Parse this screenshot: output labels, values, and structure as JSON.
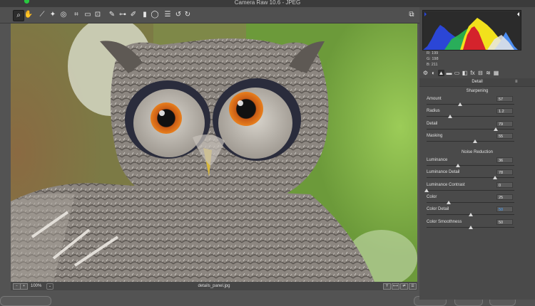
{
  "window": {
    "title": "Camera Raw 10.6  -  JPEG"
  },
  "toolbar": {
    "tools": [
      {
        "name": "zoom-tool",
        "glyph": "⌕",
        "active": true
      },
      {
        "name": "hand-tool",
        "glyph": "✋",
        "active": false
      },
      {
        "name": "white-balance-tool",
        "glyph": "⟋",
        "active": false
      },
      {
        "name": "color-sampler-tool",
        "glyph": "✦",
        "active": false
      },
      {
        "name": "targeted-adjustment-tool",
        "glyph": "◎",
        "active": false
      },
      {
        "name": "crop-tool",
        "glyph": "⌗",
        "active": false
      },
      {
        "name": "straighten-tool",
        "glyph": "▭",
        "active": false
      },
      {
        "name": "transform-tool",
        "glyph": "⊡",
        "active": false
      },
      {
        "name": "spot-removal-tool",
        "glyph": "✎",
        "active": false
      },
      {
        "name": "red-eye-tool",
        "glyph": "⊶",
        "active": false
      },
      {
        "name": "adjustment-brush-tool",
        "glyph": "✐",
        "active": false
      },
      {
        "name": "graduated-filter-tool",
        "glyph": "▮",
        "active": false
      },
      {
        "name": "radial-filter-tool",
        "glyph": "◯",
        "active": false
      },
      {
        "name": "preferences-tool",
        "glyph": "☰",
        "active": false
      },
      {
        "name": "rotate-left-tool",
        "glyph": "↺",
        "active": false
      },
      {
        "name": "rotate-right-tool",
        "glyph": "↻",
        "active": false
      }
    ],
    "fullscreen_glyph": "⧉"
  },
  "status": {
    "zoom": "100%",
    "zoom_arrow": "⌄",
    "filename": "details_panel.jpg",
    "left_buttons": [
      "−",
      "+"
    ],
    "view_buttons": [
      "Y",
      "⟷",
      "⇄",
      "☰"
    ]
  },
  "histogram": {
    "r_label": "R:",
    "r_value": "199",
    "g_label": "G:",
    "g_value": "198",
    "b_label": "B:",
    "b_value": "211"
  },
  "panel": {
    "tab_icons": [
      "⚙",
      "◐",
      "▲",
      "▬",
      "▭",
      "◧",
      "fx",
      "⊟",
      "≋",
      "▦"
    ],
    "title": "Detail",
    "sharpening": {
      "heading": "Sharpening",
      "rows": [
        {
          "label": "Amount",
          "value": "57",
          "pos": 0.38
        },
        {
          "label": "Radius",
          "value": "1.2",
          "pos": 0.27
        },
        {
          "label": "Detail",
          "value": "79",
          "pos": 0.79
        },
        {
          "label": "Masking",
          "value": "55",
          "pos": 0.55
        }
      ]
    },
    "noise": {
      "heading": "Noise Reduction",
      "rows": [
        {
          "label": "Luminance",
          "value": "36",
          "pos": 0.36
        },
        {
          "label": "Luminance Detail",
          "value": "78",
          "pos": 0.78
        },
        {
          "label": "Luminance Contrast",
          "value": "0",
          "pos": 0.0
        },
        {
          "label": "Color",
          "value": "25",
          "pos": 0.25
        },
        {
          "label": "Color Detail",
          "value": "50",
          "pos": 0.5,
          "selected": true
        },
        {
          "label": "Color Smoothness",
          "value": "50",
          "pos": 0.5
        }
      ]
    }
  }
}
